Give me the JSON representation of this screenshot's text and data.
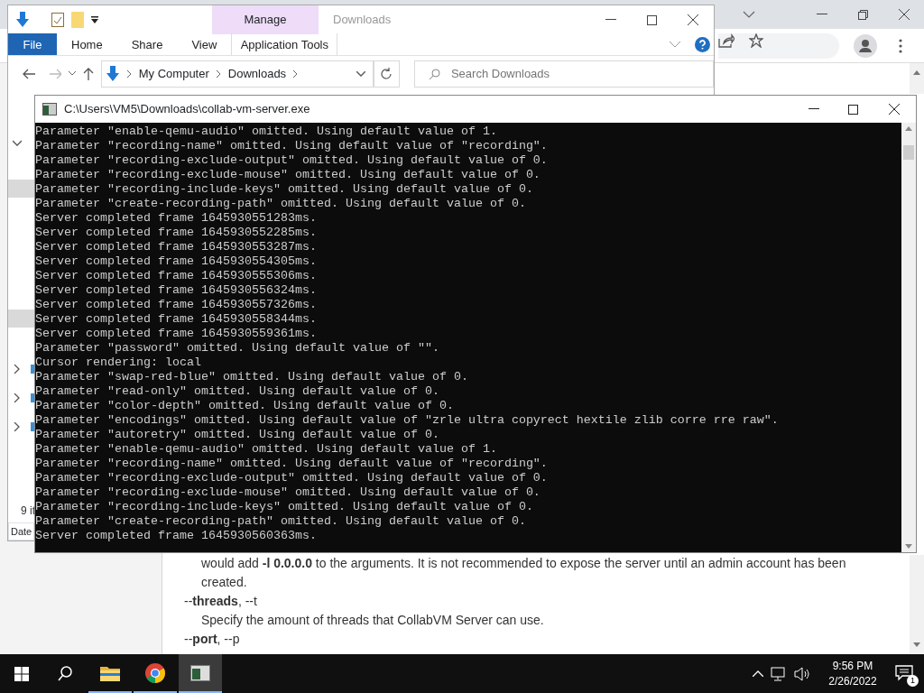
{
  "browser": {
    "page": {
      "lines": [
        {
          "kind": "paragraph",
          "text": "would add **-l 0.0.0.0** to the arguments. It is not recommended to expose the server until an admin account has been"
        },
        {
          "kind": "paragraph",
          "text": "created."
        },
        {
          "kind": "option",
          "text": "--**threads**, --t"
        },
        {
          "kind": "paragraph",
          "text": "Specify the amount of threads that CollabVM Server can use."
        },
        {
          "kind": "option",
          "text": "--**port**, --p"
        }
      ]
    }
  },
  "explorer": {
    "title": "Downloads",
    "context_tab": "Manage",
    "ribbon_tabs": [
      {
        "label": "File",
        "kind": "file"
      },
      {
        "label": "Home",
        "kind": "tab"
      },
      {
        "label": "Share",
        "kind": "tab"
      },
      {
        "label": "View",
        "kind": "tab"
      },
      {
        "label": "Application Tools",
        "kind": "context"
      }
    ],
    "breadcrumb": [
      "My Computer",
      "Downloads"
    ],
    "search": {
      "placeholder": "Search Downloads"
    },
    "nav_items": [
      {
        "kind": "expander",
        "expanded": true,
        "selected": false
      },
      {
        "kind": "row",
        "selected": true
      },
      {
        "kind": "row",
        "selected": true
      },
      {
        "kind": "expander",
        "expanded": false,
        "selected": false
      },
      {
        "kind": "expander",
        "expanded": false,
        "selected": false
      },
      {
        "kind": "expander",
        "expanded": false,
        "selected": false
      }
    ],
    "status": "9 it",
    "column_header": "Date"
  },
  "console": {
    "title": "C:\\Users\\VM5\\Downloads\\collab-vm-server.exe",
    "lines": [
      "Parameter \"enable-qemu-audio\" omitted. Using default value of 1.",
      "Parameter \"recording-name\" omitted. Using default value of \"recording\".",
      "Parameter \"recording-exclude-output\" omitted. Using default value of 0.",
      "Parameter \"recording-exclude-mouse\" omitted. Using default value of 0.",
      "Parameter \"recording-include-keys\" omitted. Using default value of 0.",
      "Parameter \"create-recording-path\" omitted. Using default value of 0.",
      "Server completed frame 1645930551283ms.",
      "Server completed frame 1645930552285ms.",
      "Server completed frame 1645930553287ms.",
      "Server completed frame 1645930554305ms.",
      "Server completed frame 1645930555306ms.",
      "Server completed frame 1645930556324ms.",
      "Server completed frame 1645930557326ms.",
      "Server completed frame 1645930558344ms.",
      "Server completed frame 1645930559361ms.",
      "Parameter \"password\" omitted. Using default value of \"\".",
      "Cursor rendering: local",
      "Parameter \"swap-red-blue\" omitted. Using default value of 0.",
      "Parameter \"read-only\" omitted. Using default value of 0.",
      "Parameter \"color-depth\" omitted. Using default value of 0.",
      "Parameter \"encodings\" omitted. Using default value of \"zrle ultra copyrect hextile zlib corre rre raw\".",
      "Parameter \"autoretry\" omitted. Using default value of 0.",
      "Parameter \"enable-qemu-audio\" omitted. Using default value of 1.",
      "Parameter \"recording-name\" omitted. Using default value of \"recording\".",
      "Parameter \"recording-exclude-output\" omitted. Using default value of 0.",
      "Parameter \"recording-exclude-mouse\" omitted. Using default value of 0.",
      "Parameter \"recording-include-keys\" omitted. Using default value of 0.",
      "Parameter \"create-recording-path\" omitted. Using default value of 0.",
      "Server completed frame 1645930560363ms."
    ]
  },
  "taskbar": {
    "apps": [
      {
        "kind": "folder",
        "selected": false
      },
      {
        "kind": "browser",
        "selected": false
      },
      {
        "kind": "console",
        "selected": true
      }
    ],
    "time": "9:56 PM",
    "date": "2/26/2022",
    "notifications": "1"
  }
}
